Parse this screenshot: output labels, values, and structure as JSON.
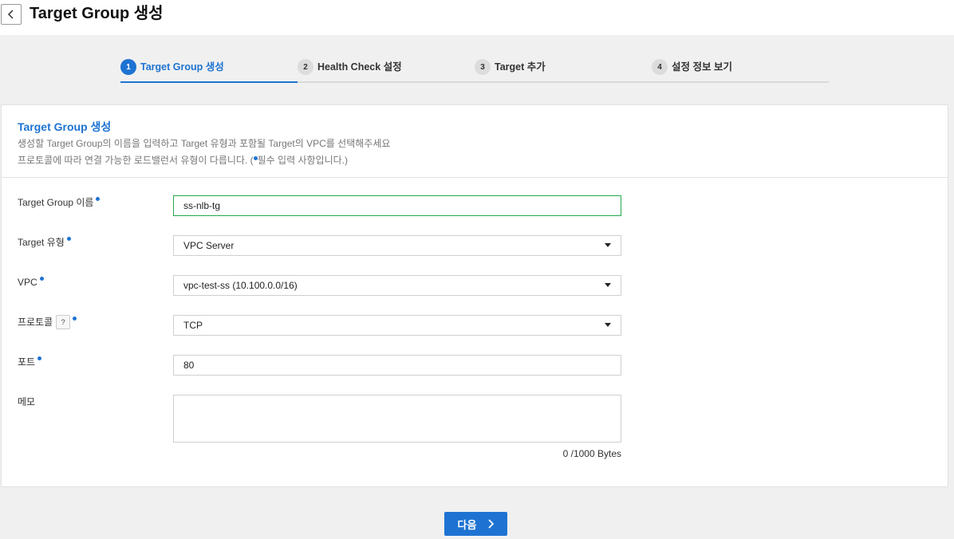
{
  "header": {
    "title": "Target Group 생성"
  },
  "steps": [
    {
      "number": "1",
      "label": "Target Group 생성",
      "active": true
    },
    {
      "number": "2",
      "label": "Health Check 설정",
      "active": false
    },
    {
      "number": "3",
      "label": "Target 추가",
      "active": false
    },
    {
      "number": "4",
      "label": "설정 정보 보기",
      "active": false
    }
  ],
  "card": {
    "title": "Target Group 생성",
    "desc_line1": "생성할 Target Group의 이름을 입력하고 Target 유형과 포함될 Target의 VPC를 선택해주세요",
    "desc_line2_prefix": "프로토콜에 따라 연결 가능한 로드밸런서 유형이 다릅니다. (",
    "desc_line2_suffix": "필수 입력 사항입니다.)"
  },
  "form": {
    "name": {
      "label": "Target Group 이름",
      "value": "ss-nlb-tg"
    },
    "target_type": {
      "label": "Target 유형",
      "value": "VPC Server"
    },
    "vpc": {
      "label": "VPC",
      "value": "vpc-test-ss (10.100.0.0/16)"
    },
    "protocol": {
      "label": "프로토콜",
      "value": "TCP",
      "help_icon": "?"
    },
    "port": {
      "label": "포트",
      "value": "80"
    },
    "memo": {
      "label": "메모",
      "value": "",
      "byte_count": "0 /1000 Bytes"
    }
  },
  "footer": {
    "next_label": "다음"
  },
  "colors": {
    "accent": "#1e73d2",
    "focus_border": "#23a849"
  }
}
